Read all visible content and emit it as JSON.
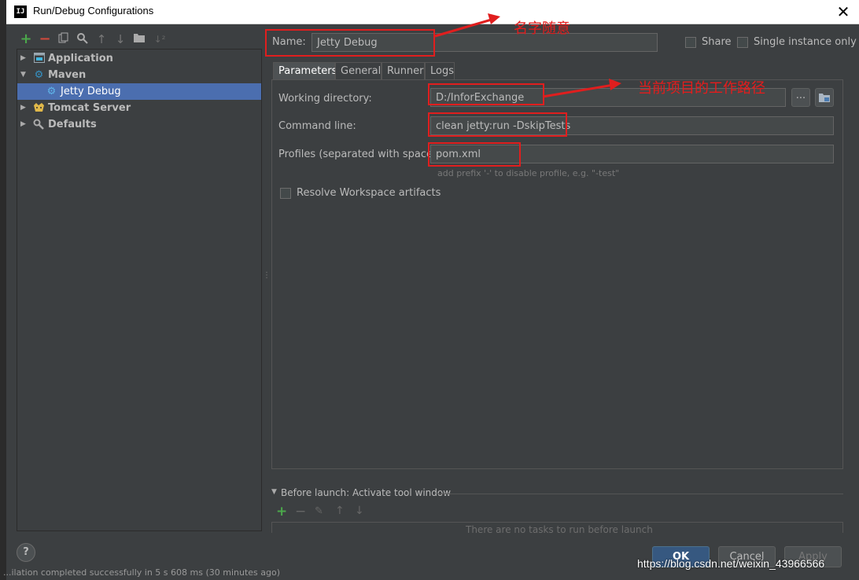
{
  "window": {
    "title": "Run/Debug Configurations",
    "logo_text": "IJ",
    "close_glyph": "✕"
  },
  "toolbar": {
    "icons": [
      "add-icon",
      "remove-icon",
      "copy-icon",
      "edit-defaults-icon",
      "move-up-icon",
      "move-down-icon",
      "folder-icon",
      "sort-icon"
    ]
  },
  "tree": {
    "items": [
      {
        "label": "Application",
        "icon": "application-icon"
      },
      {
        "label": "Maven",
        "icon": "maven-gear-icon"
      },
      {
        "label": "Jetty Debug",
        "icon": "maven-config-icon"
      },
      {
        "label": "Tomcat Server",
        "icon": "tomcat-icon"
      },
      {
        "label": "Defaults",
        "icon": "defaults-wrench-icon"
      }
    ]
  },
  "name_row": {
    "label": "Name:",
    "value": "Jetty Debug",
    "share_label": "Share",
    "single_instance_label": "Single instance only"
  },
  "tabs": [
    "Parameters",
    "General",
    "Runner",
    "Logs"
  ],
  "parameters": {
    "working_dir_label": "Working directory:",
    "working_dir_value": "D:/InforExchange",
    "browse_glyph": "...",
    "command_line_label": "Command line:",
    "command_line_value": "clean jetty:run -DskipTests",
    "profiles_label": "Profiles (separated with space):",
    "profiles_value": "pom.xml",
    "profiles_hint": "add prefix '-' to disable profile, e.g. \"-test\"",
    "resolve_label": "Resolve Workspace artifacts"
  },
  "before_launch": {
    "title": "Before launch: Activate tool window",
    "empty_text": "There are no tasks to run before launch"
  },
  "buttons": {
    "ok": "OK",
    "cancel": "Cancel",
    "apply": "Apply",
    "help_glyph": "?"
  },
  "annotations": {
    "name_note": "名字随意",
    "dir_note": "当前项目的工作路径",
    "color": "#e51c1c"
  },
  "watermark": "https://blog.csdn.net/weixin_43966566",
  "background_text": "...ilation completed successfully in 5 s 608 ms (30 minutes ago)",
  "colors": {
    "background": "#3c3f41",
    "selection": "#4b6eaf",
    "primary_button": "#365880"
  }
}
